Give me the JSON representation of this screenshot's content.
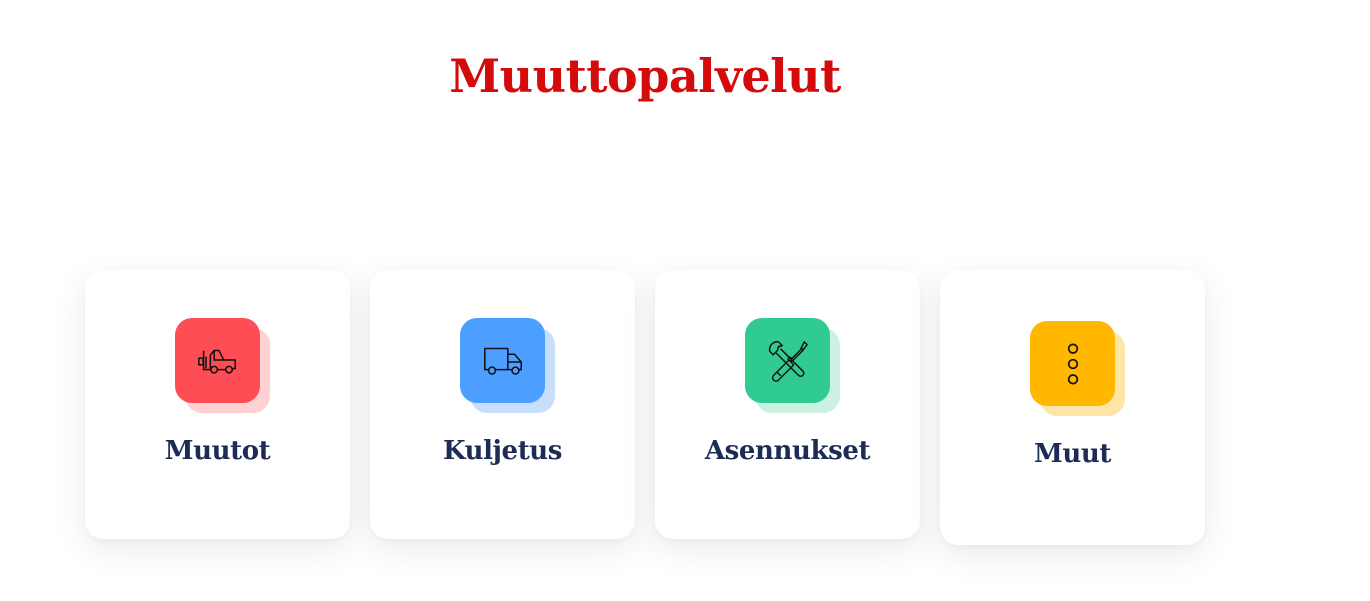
{
  "page": {
    "title": "Muuttopalvelut",
    "title_color": "#d40b0b",
    "label_color": "#1d2b57"
  },
  "services": [
    {
      "label": "Muutot",
      "icon": "forklift-icon",
      "color": "#ff4d55",
      "shadow_color": "#ffd1d3"
    },
    {
      "label": "Kuljetus",
      "icon": "truck-icon",
      "color": "#4d9fff",
      "shadow_color": "#c8dffc"
    },
    {
      "label": "Asennukset",
      "icon": "tools-icon",
      "color": "#2fcb91",
      "shadow_color": "#cbf1e3"
    },
    {
      "label": "Muut",
      "icon": "more-vertical-icon",
      "color": "#ffb700",
      "shadow_color": "#fde6a8"
    }
  ]
}
